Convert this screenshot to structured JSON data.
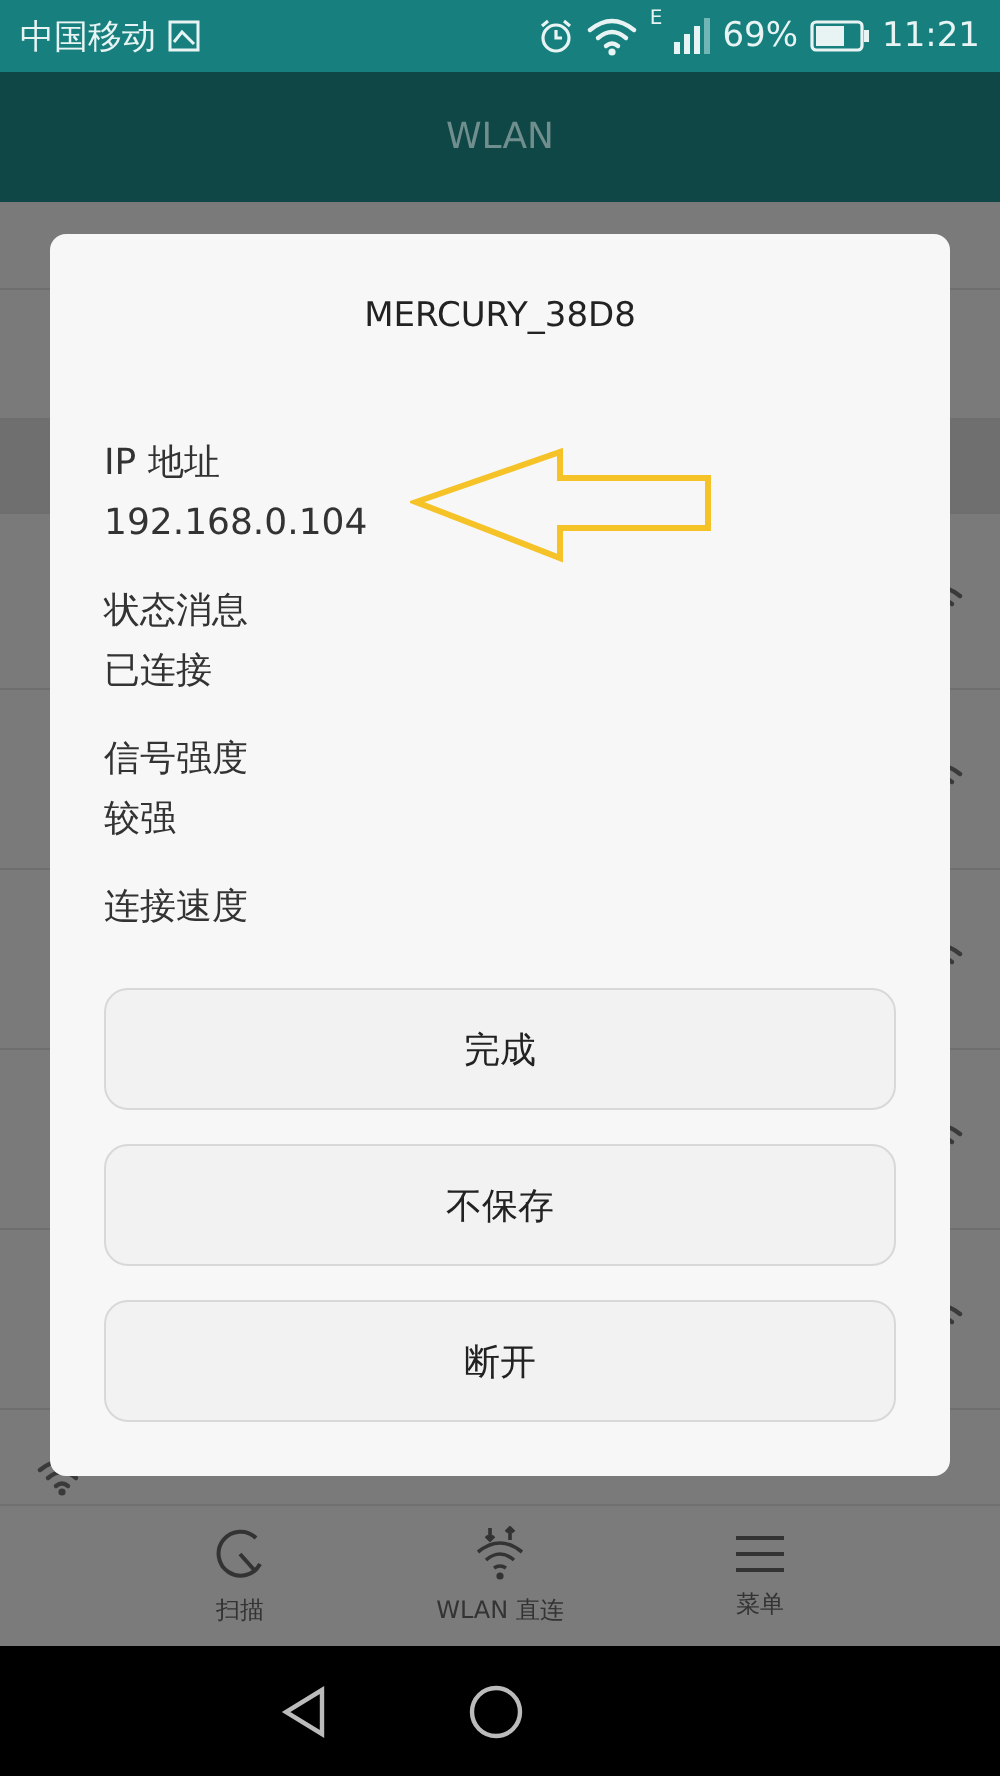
{
  "status_bar": {
    "carrier": "中国移动",
    "network_type": "E",
    "battery": "69%",
    "time": "11:21"
  },
  "app_bar": {
    "title": "WLAN"
  },
  "dialog": {
    "title": "MERCURY_38D8",
    "fields": [
      {
        "label": "IP 地址",
        "value": "192.168.0.104",
        "highlighted": true
      },
      {
        "label": "状态消息",
        "value": "已连接",
        "highlighted": false
      },
      {
        "label": "信号强度",
        "value": "较强",
        "highlighted": false
      },
      {
        "label": "连接速度",
        "highlighted": false
      }
    ],
    "buttons": [
      "完成",
      "不保存",
      "断开"
    ]
  },
  "bottom_nav": [
    {
      "kind": "scan",
      "label": "扫描"
    },
    {
      "kind": "direct",
      "label": "WLAN 直连"
    },
    {
      "kind": "menu",
      "label": "菜单"
    }
  ]
}
